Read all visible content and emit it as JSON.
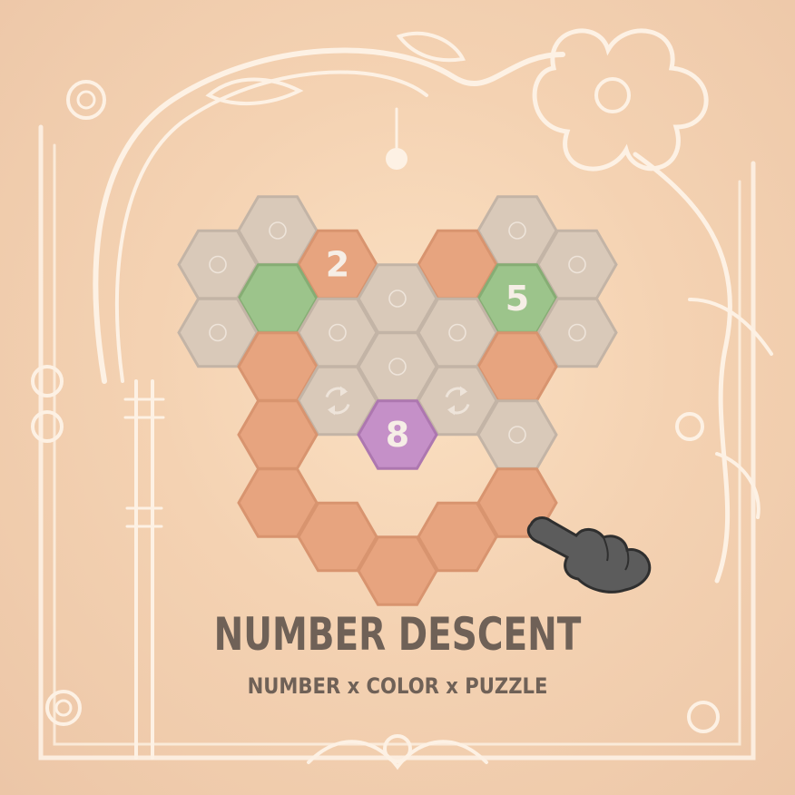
{
  "title": "NUMBER DESCENT",
  "subtitle": "NUMBER x COLOR x PUZZLE",
  "colors": {
    "empty": "#d9c9b9",
    "path": "#e7a47f",
    "green": "#9cc48b",
    "purple": "#c590c8",
    "text": "#6f6157",
    "ornament": "#fdf1e4"
  },
  "board": {
    "cells": [
      {
        "c": 1,
        "r": 0,
        "type": "empty",
        "icon": "circle"
      },
      {
        "c": 5,
        "r": 0,
        "type": "empty",
        "icon": "circle"
      },
      {
        "c": 0,
        "r": 0.5,
        "type": "empty",
        "icon": "circle"
      },
      {
        "c": 2,
        "r": 0.5,
        "type": "path",
        "label": "2"
      },
      {
        "c": 4,
        "r": 0.5,
        "type": "path"
      },
      {
        "c": 6,
        "r": 0.5,
        "type": "empty",
        "icon": "circle"
      },
      {
        "c": 1,
        "r": 1,
        "type": "green"
      },
      {
        "c": 3,
        "r": 1,
        "type": "empty",
        "icon": "circle"
      },
      {
        "c": 5,
        "r": 1,
        "type": "green",
        "label": "5"
      },
      {
        "c": 0,
        "r": 1.5,
        "type": "empty",
        "icon": "circle"
      },
      {
        "c": 2,
        "r": 1.5,
        "type": "empty",
        "icon": "circle"
      },
      {
        "c": 4,
        "r": 1.5,
        "type": "empty",
        "icon": "circle"
      },
      {
        "c": 6,
        "r": 1.5,
        "type": "empty",
        "icon": "circle"
      },
      {
        "c": 1,
        "r": 2,
        "type": "path"
      },
      {
        "c": 3,
        "r": 2,
        "type": "empty",
        "icon": "circle"
      },
      {
        "c": 5,
        "r": 2,
        "type": "path"
      },
      {
        "c": 2,
        "r": 2.5,
        "type": "empty",
        "icon": "rotate"
      },
      {
        "c": 4,
        "r": 2.5,
        "type": "empty",
        "icon": "rotate"
      },
      {
        "c": 1,
        "r": 3,
        "type": "path"
      },
      {
        "c": 3,
        "r": 3,
        "type": "purple",
        "label": "8"
      },
      {
        "c": 5,
        "r": 3,
        "type": "empty",
        "icon": "circle"
      },
      {
        "c": 1,
        "r": 4,
        "type": "path"
      },
      {
        "c": 5,
        "r": 4,
        "type": "path"
      },
      {
        "c": 2,
        "r": 4.5,
        "type": "path"
      },
      {
        "c": 4,
        "r": 4.5,
        "type": "path"
      },
      {
        "c": 3,
        "r": 5,
        "type": "path"
      }
    ]
  },
  "pointer": {
    "icon": "pointing-hand-icon"
  }
}
